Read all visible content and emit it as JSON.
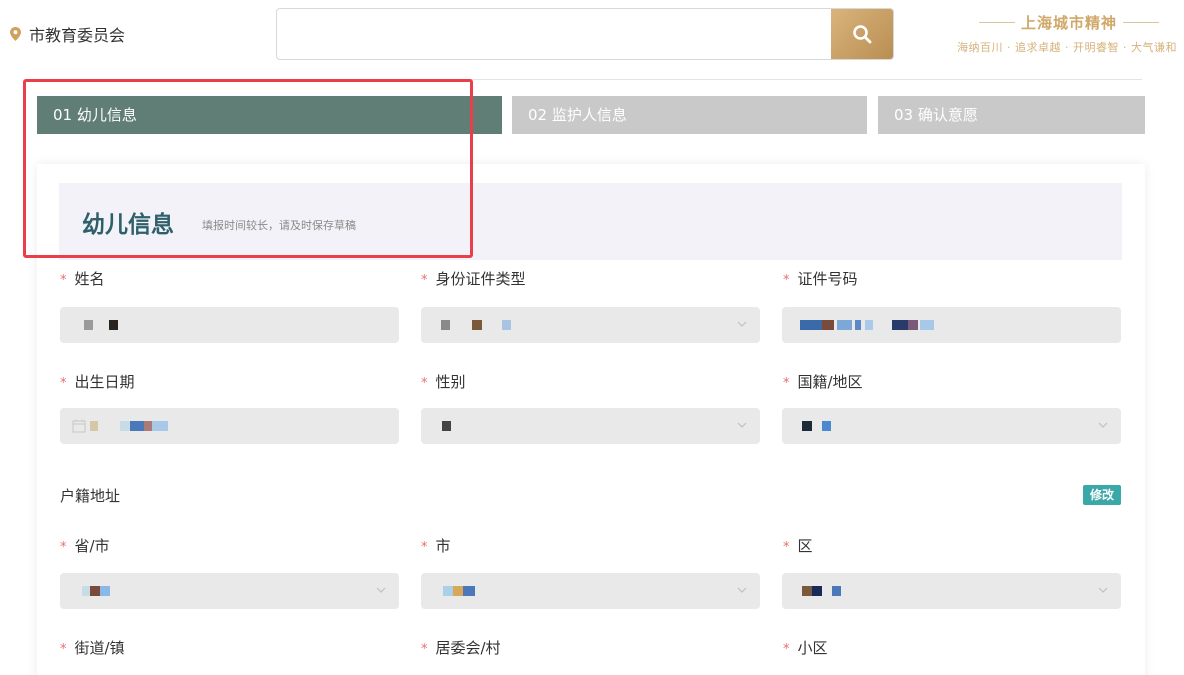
{
  "header": {
    "location": "市教育委员会",
    "search": {
      "value": "",
      "placeholder": ""
    },
    "slogan": {
      "title": "上海城市精神",
      "subtitle": "海纳百川 · 追求卓越 · 开明睿智 · 大气谦和"
    }
  },
  "steps": [
    {
      "label": "01 幼儿信息",
      "active": true
    },
    {
      "label": "02 监护人信息",
      "active": false
    },
    {
      "label": "03 确认意愿",
      "active": false
    }
  ],
  "section": {
    "title": "幼儿信息",
    "hint": "填报时间较长，请及时保存草稿"
  },
  "fields": {
    "name": {
      "label": "姓名",
      "required": true
    },
    "id_type": {
      "label": "身份证件类型",
      "required": true
    },
    "id_number": {
      "label": "证件号码",
      "required": true
    },
    "birth_date": {
      "label": "出生日期",
      "required": true
    },
    "gender": {
      "label": "性别",
      "required": true
    },
    "nationality": {
      "label": "国籍/地区",
      "required": true
    },
    "province": {
      "label": "省/市",
      "required": true
    },
    "city": {
      "label": "市",
      "required": true
    },
    "district": {
      "label": "区",
      "required": true
    },
    "street": {
      "label": "街道/镇",
      "required": true
    },
    "committee": {
      "label": "居委会/村",
      "required": true
    },
    "community": {
      "label": "小区",
      "required": true
    }
  },
  "household": {
    "label": "户籍地址",
    "edit_label": "修改"
  },
  "required_mark": "*",
  "colors": {
    "active_step": "#617e76",
    "inactive_step": "#c9c9c9",
    "accent_gold": "#c9a063",
    "edit_badge": "#3aa7a8",
    "required": "#ea6d6d",
    "highlight_box": "#ea3f4b"
  }
}
